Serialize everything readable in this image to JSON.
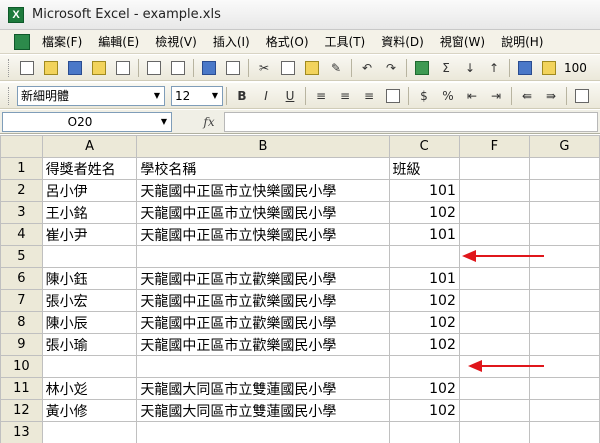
{
  "window": {
    "title": "Microsoft Excel - example.xls",
    "app_icon": "X"
  },
  "menu": {
    "items": [
      "檔案(F)",
      "編輯(E)",
      "檢視(V)",
      "插入(I)",
      "格式(O)",
      "工具(T)",
      "資料(D)",
      "視窗(W)",
      "說明(H)"
    ]
  },
  "toolbar": {
    "standard": {
      "sigma": "Σ",
      "zoom": "100"
    },
    "format": {
      "font_name": "新細明體",
      "font_size": "12",
      "bold": "B",
      "italic": "I",
      "underline": "U",
      "currency": "$",
      "percent": "%"
    }
  },
  "formula_bar": {
    "name_box": "O20",
    "fx": "fx"
  },
  "sheet": {
    "columns": [
      "A",
      "B",
      "C",
      "F",
      "G"
    ],
    "rows": [
      {
        "num": "1",
        "a": "得獎者姓名",
        "b": "學校名稱",
        "c": "班級"
      },
      {
        "num": "2",
        "a": "呂小伊",
        "b": "天龍國中正區市立快樂國民小學",
        "c": "101"
      },
      {
        "num": "3",
        "a": "王小銘",
        "b": "天龍國中正區市立快樂國民小學",
        "c": "102"
      },
      {
        "num": "4",
        "a": "崔小尹",
        "b": "天龍國中正區市立快樂國民小學",
        "c": "101"
      },
      {
        "num": "5",
        "a": "",
        "b": "",
        "c": ""
      },
      {
        "num": "6",
        "a": "陳小鈺",
        "b": "天龍國中正區市立歡樂國民小學",
        "c": "101"
      },
      {
        "num": "7",
        "a": "張小宏",
        "b": "天龍國中正區市立歡樂國民小學",
        "c": "102"
      },
      {
        "num": "8",
        "a": "陳小辰",
        "b": "天龍國中正區市立歡樂國民小學",
        "c": "102"
      },
      {
        "num": "9",
        "a": "張小瑜",
        "b": "天龍國中正區市立歡樂國民小學",
        "c": "102"
      },
      {
        "num": "10",
        "a": "",
        "b": "",
        "c": ""
      },
      {
        "num": "11",
        "a": "林小彣",
        "b": "天龍國大同區市立雙蓮國民小學",
        "c": "102"
      },
      {
        "num": "12",
        "a": "黃小修",
        "b": "天龍國大同區市立雙蓮國民小學",
        "c": "102"
      },
      {
        "num": "13",
        "a": "",
        "b": "",
        "c": ""
      }
    ]
  },
  "colors": {
    "annotation_arrow": "#e0161b",
    "header_bg": "#ece9d8"
  }
}
